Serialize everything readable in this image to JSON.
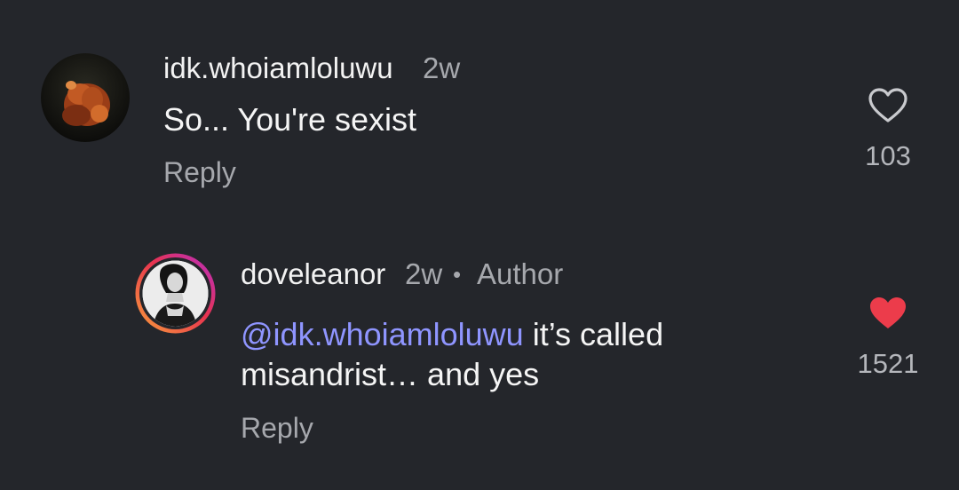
{
  "comments": [
    {
      "username": "idk.whoiamloluwu",
      "time": "2w",
      "text": "So... You're sexist",
      "reply_label": "Reply",
      "like_count": "103",
      "liked": false,
      "avatar_icon": "orange-fox-avatar"
    },
    {
      "username": "doveleanor",
      "time": "2w",
      "separator": "•",
      "author_badge": "Author",
      "mention": "@idk.whoiamloluwu",
      "text_line1_rest": " it’s called",
      "text_line2": "misandrist… and yes",
      "reply_label": "Reply",
      "like_count": "1521",
      "liked": true,
      "avatar_icon": "bw-portrait-avatar",
      "story_ring": true
    }
  ],
  "colors": {
    "background": "#24262b",
    "mention": "#8f95ff",
    "heart_liked": "#ec3c4b",
    "muted_text": "#a6a8ad"
  }
}
